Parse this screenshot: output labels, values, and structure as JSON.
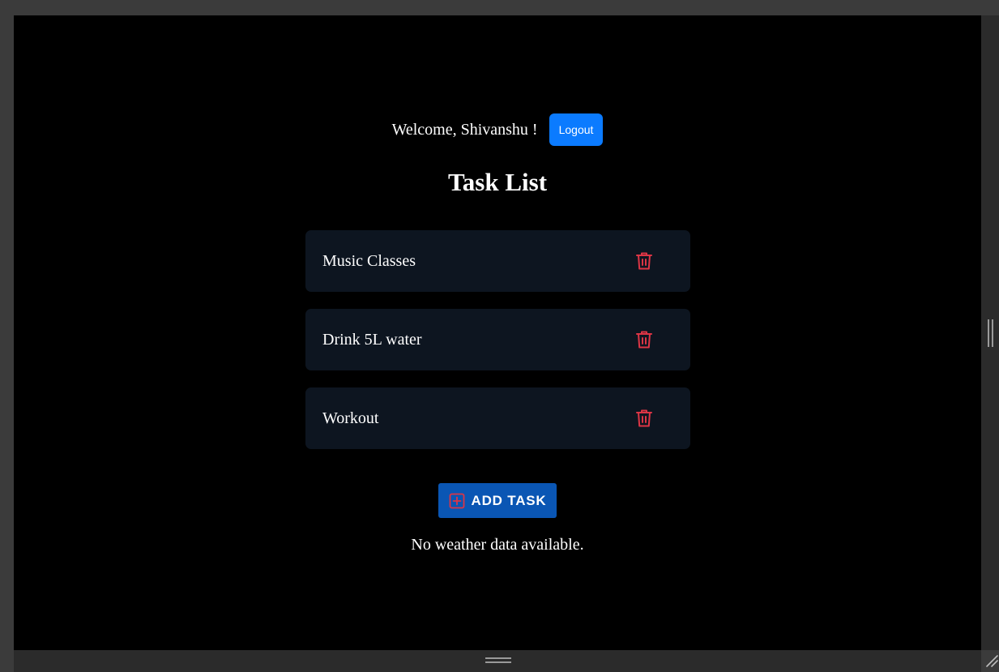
{
  "header": {
    "welcome": "Welcome, Shivanshu !",
    "logout_label": "Logout"
  },
  "page": {
    "title": "Task List"
  },
  "tasks": [
    {
      "label": "Music Classes",
      "action_icon": "trash-icon"
    },
    {
      "label": "Drink 5L water",
      "action_icon": "trash-icon"
    },
    {
      "label": "Workout",
      "action_icon": "trash-icon"
    }
  ],
  "add_task": {
    "label": "ADD TASK",
    "icon": "plus-square-icon"
  },
  "weather": {
    "message": "No weather data available."
  },
  "colors": {
    "background": "#000000",
    "card": "#0d1520",
    "primary": "#0b7bff",
    "add_button": "#0a56b4",
    "danger": "#dc3545",
    "text": "#ffffff"
  }
}
